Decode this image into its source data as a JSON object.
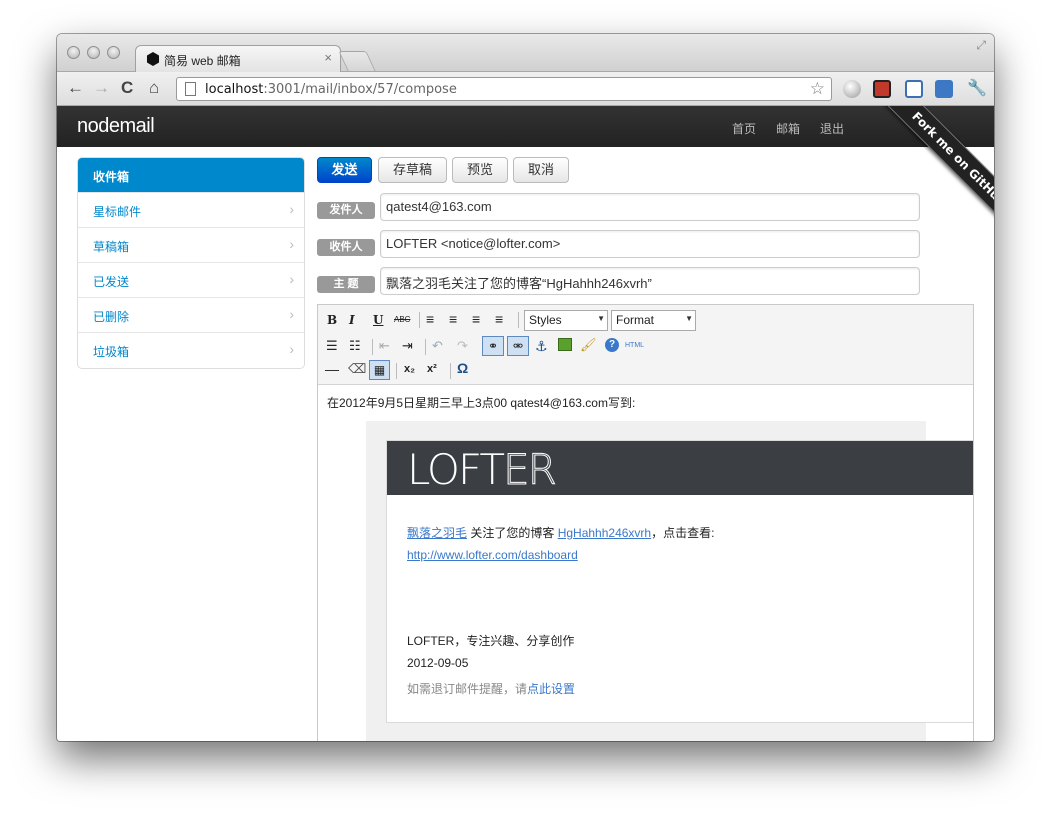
{
  "browser": {
    "tab_title": "简易 web 邮箱",
    "url_host": "localhost",
    "url_rest": ":3001/mail/inbox/57/compose"
  },
  "app": {
    "brand": "nodemail",
    "nav": [
      "首页",
      "邮箱",
      "退出"
    ],
    "ribbon": "Fork me on GitHub"
  },
  "sidebar": {
    "items": [
      {
        "label": "收件箱",
        "active": true
      },
      {
        "label": "星标邮件"
      },
      {
        "label": "草稿箱"
      },
      {
        "label": "已发送"
      },
      {
        "label": "已删除"
      },
      {
        "label": "垃圾箱"
      }
    ]
  },
  "actions": {
    "send": "发送",
    "save_draft": "存草稿",
    "preview": "预览",
    "cancel": "取消"
  },
  "fields": {
    "from_label": "发件人",
    "from_value": "qatest4@163.com",
    "to_label": "收件人",
    "to_value": "LOFTER <notice@lofter.com>",
    "subject_label": "主 题",
    "subject_value": "飘落之羽毛关注了您的博客“HgHahhh246xvrh”"
  },
  "editor": {
    "styles_label": "Styles",
    "format_label": "Format",
    "html_label": "HTML",
    "quote_intro": "在2012年9月5日星期三早上3点00 qatest4@163.com写到:"
  },
  "email": {
    "logo_bold": "LOFT",
    "logo_thin": "ER",
    "follower": "飘落之羽毛",
    "follow_text": " 关注了您的博客 ",
    "blog": "HgHahhh246xvrh",
    "click_text": "，点击查看:",
    "link": "http://www.lofter.com/dashboard",
    "signature": "LOFTER，专注兴趣、分享创作",
    "date": "2012-09-05",
    "unsub_prefix": "如需退订邮件提醒，请",
    "unsub_link": "点此设置"
  }
}
